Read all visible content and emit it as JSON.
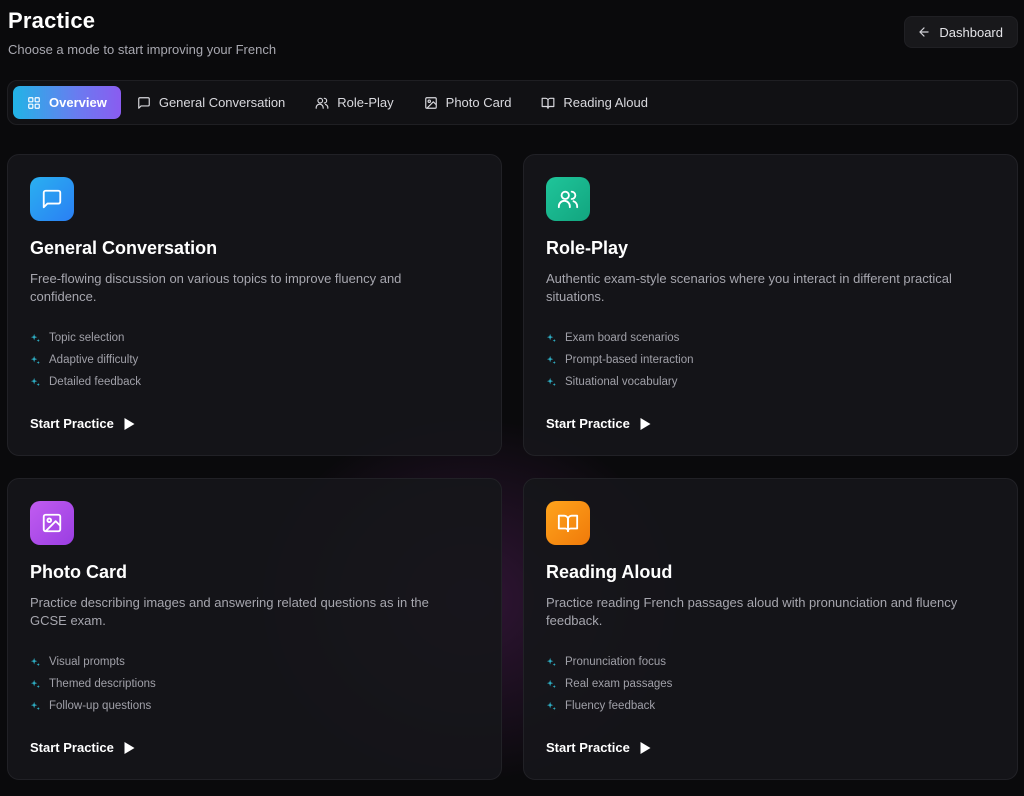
{
  "header": {
    "title": "Practice",
    "subtitle": "Choose a mode to start improving your French",
    "dashboard_label": "Dashboard"
  },
  "tabs": [
    {
      "label": "Overview",
      "icon": "grid-icon",
      "active": true
    },
    {
      "label": "General Conversation",
      "icon": "message-icon",
      "active": false
    },
    {
      "label": "Role-Play",
      "icon": "users-icon",
      "active": false
    },
    {
      "label": "Photo Card",
      "icon": "image-icon",
      "active": false
    },
    {
      "label": "Reading Aloud",
      "icon": "book-icon",
      "active": false
    }
  ],
  "cards": [
    {
      "title": "General Conversation",
      "description": "Free-flowing discussion on various topics to improve fluency and confidence.",
      "icon": "message-icon",
      "icon_color": "#2a9df4",
      "features": [
        "Topic selection",
        "Adaptive difficulty",
        "Detailed feedback"
      ],
      "cta": "Start Practice"
    },
    {
      "title": "Role-Play",
      "description": "Authentic exam-style scenarios where you interact in different practical situations.",
      "icon": "users-icon",
      "icon_color": "#18b48a",
      "features": [
        "Exam board scenarios",
        "Prompt-based interaction",
        "Situational vocabulary"
      ],
      "cta": "Start Practice"
    },
    {
      "title": "Photo Card",
      "description": "Practice describing images and answering related questions as in the GCSE exam.",
      "icon": "image-icon",
      "icon_color": "#b04ee8",
      "features": [
        "Visual prompts",
        "Themed descriptions",
        "Follow-up questions"
      ],
      "cta": "Start Practice"
    },
    {
      "title": "Reading Aloud",
      "description": "Practice reading French passages aloud with pronunciation and fluency feedback.",
      "icon": "book-icon",
      "icon_color": "#f5900f",
      "features": [
        "Pronunciation focus",
        "Real exam passages",
        "Fluency feedback"
      ],
      "cta": "Start Practice"
    }
  ],
  "colors": {
    "accent_start": "#21b4e6",
    "accent_end": "#8a5cf0",
    "feature_icon": "#2fb3c9"
  }
}
